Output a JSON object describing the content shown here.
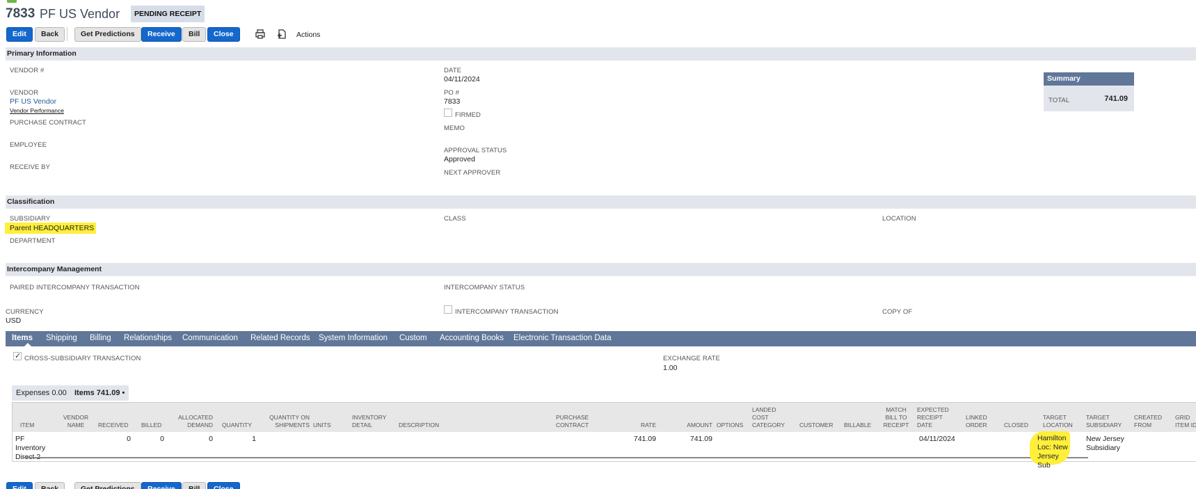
{
  "header": {
    "record_number": "7833",
    "vendor_name": "PF US Vendor",
    "status": "PENDING RECEIPT"
  },
  "toolbar": {
    "edit": "Edit",
    "back": "Back",
    "get_predictions": "Get Predictions",
    "receive": "Receive",
    "bill": "Bill",
    "close": "Close",
    "actions": "Actions"
  },
  "primary": {
    "title": "Primary Information",
    "vendor_no_label": "VENDOR #",
    "vendor_label": "VENDOR",
    "vendor_value": "PF US Vendor",
    "vendor_performance": "Vendor Performance",
    "purchase_contract_label": "PURCHASE CONTRACT",
    "employee_label": "EMPLOYEE",
    "receive_by_label": "RECEIVE BY",
    "date_label": "DATE",
    "date_value": "04/11/2024",
    "po_label": "PO #",
    "po_value": "7833",
    "firmed_label": "FIRMED",
    "memo_label": "MEMO",
    "approval_status_label": "APPROVAL STATUS",
    "approval_status_value": "Approved",
    "next_approver_label": "NEXT APPROVER"
  },
  "summary": {
    "title": "Summary",
    "total_label": "TOTAL",
    "total_value": "741.09"
  },
  "classification": {
    "title": "Classification",
    "subsidiary_label": "SUBSIDIARY",
    "subsidiary_value": "Parent HEADQUARTERS",
    "department_label": "DEPARTMENT",
    "class_label": "CLASS",
    "location_label": "LOCATION"
  },
  "intercompany": {
    "title": "Intercompany Management",
    "paired_label": "PAIRED INTERCOMPANY TRANSACTION",
    "status_label": "INTERCOMPANY STATUS",
    "currency_label": "CURRENCY",
    "currency_value": "USD",
    "ic_transaction_label": "INTERCOMPANY TRANSACTION",
    "copy_of_label": "COPY OF"
  },
  "tabs": [
    "Items",
    "Shipping",
    "Billing",
    "Relationships",
    "Communication",
    "Related Records",
    "System Information",
    "Custom",
    "Accounting Books",
    "Electronic Transaction Data"
  ],
  "items_tab": {
    "cross_subsidiary_label": "CROSS-SUBSIDIARY TRANSACTION",
    "exchange_rate_label": "EXCHANGE RATE",
    "exchange_rate_value": "1.00",
    "subtab_expenses": "Expenses 0.00",
    "subtab_items": "Items 741.09 •"
  },
  "grid": {
    "columns": {
      "item": "ITEM",
      "vendor_name": "VENDOR NAME",
      "received": "RECEIVED",
      "billed": "BILLED",
      "allocated_demand": "ALLOCATED DEMAND",
      "quantity": "QUANTITY",
      "qty_on_shipments": "QUANTITY ON SHIPMENTS",
      "units": "UNITS",
      "inventory_detail": "INVENTORY DETAIL",
      "description": "DESCRIPTION",
      "purchase_contract": "PURCHASE CONTRACT",
      "rate": "RATE",
      "amount": "AMOUNT",
      "options": "OPTIONS",
      "landed_cost_category": "LANDED COST CATEGORY",
      "customer": "CUSTOMER",
      "billable": "BILLABLE",
      "match_bill": "MATCH BILL TO RECEIPT",
      "expected_receipt": "EXPECTED RECEIPT DATE",
      "linked_order": "LINKED ORDER",
      "closed": "CLOSED",
      "target_location": "TARGET LOCATION",
      "target_subsidiary": "TARGET SUBSIDIARY",
      "created_from": "CREATED FROM",
      "grid_item_id": "GRID ITEM ID"
    },
    "row": {
      "item": "PF Inventory Direct 2",
      "received": "0",
      "billed": "0",
      "allocated_demand": "0",
      "quantity": "1",
      "rate": "741.09",
      "amount": "741.09",
      "expected_receipt": "04/11/2024",
      "target_location": "Hamilton Loc: New Jersey Sub",
      "target_subsidiary": "New Jersey Subsidiary"
    }
  }
}
